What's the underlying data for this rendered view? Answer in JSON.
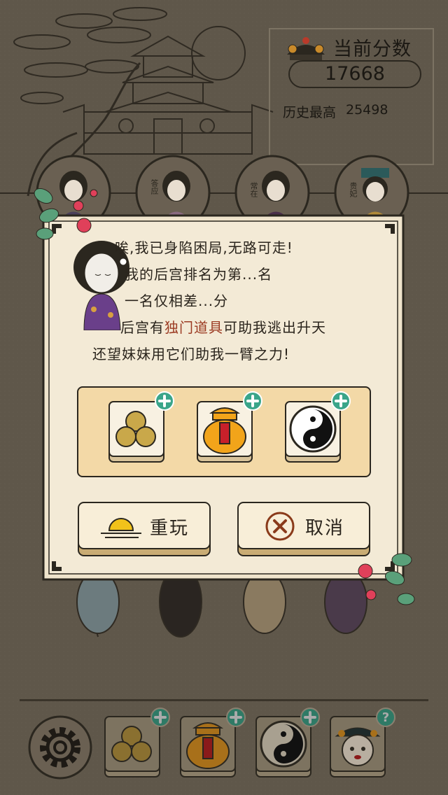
{
  "score": {
    "title": "当前分数",
    "current": "17668",
    "best_label": "历史最高",
    "best_value": "25498"
  },
  "characters": [
    {
      "name": "",
      "icon": "concubine-portrait-icon"
    },
    {
      "name": "答应",
      "icon": "concubine-portrait-icon"
    },
    {
      "name": "常在",
      "icon": "concubine-portrait-icon"
    },
    {
      "name": "贵妃",
      "icon": "empress-portrait-icon"
    }
  ],
  "dialog": {
    "lines": [
      {
        "text": "唉,我已身陷困局,无路可走!"
      },
      {
        "text": "我的后宫排名为第...名"
      },
      {
        "text": "一名仅相差...分"
      },
      {
        "prefix": "后宫有",
        "highlight": "独门道具",
        "suffix": "可助我逃出升天"
      },
      {
        "text": "还望妹妹用它们助我一臂之力!"
      }
    ],
    "items": [
      {
        "icon": "coins-icon",
        "action": "plus-icon"
      },
      {
        "icon": "treasure-jar-icon",
        "action": "plus-icon"
      },
      {
        "icon": "yin-yang-icon",
        "action": "plus-icon"
      }
    ],
    "replay_label": "重玩",
    "cancel_label": "取消"
  },
  "toolbar": {
    "settings_icon": "gear-icon",
    "tools": [
      {
        "icon": "coins-icon",
        "badge": "plus-icon"
      },
      {
        "icon": "treasure-jar-icon",
        "badge": "plus-icon"
      },
      {
        "icon": "yin-yang-icon",
        "badge": "plus-icon"
      },
      {
        "icon": "empress-portrait-icon",
        "badge": "help-icon"
      }
    ]
  },
  "colors": {
    "background": "#5f574a",
    "paper": "#f3ead6",
    "shelf": "#f3d9a7",
    "accent_red": "#9b3a22",
    "badge_teal": "#3aa58a"
  }
}
